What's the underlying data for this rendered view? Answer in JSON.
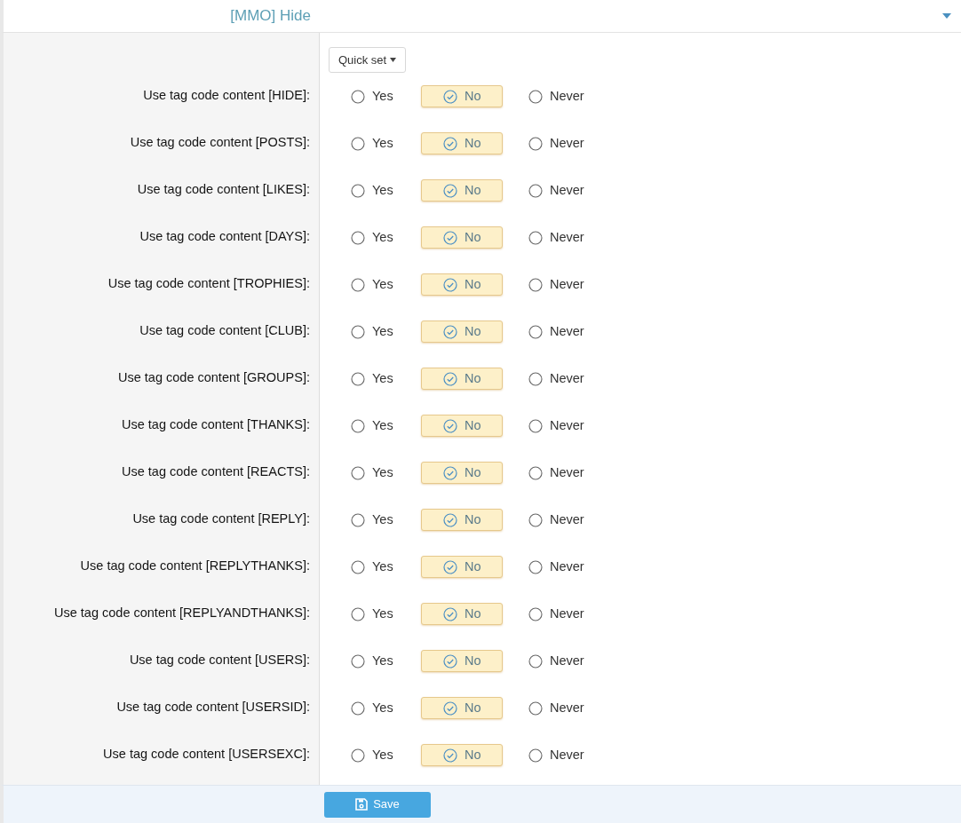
{
  "header": {
    "title": "[MMO] Hide"
  },
  "quick_set": {
    "label": "Quick set"
  },
  "rows": [
    {
      "label": "Use tag code content [HIDE]:",
      "options": [
        {
          "label": "Yes",
          "selected": false
        },
        {
          "label": "No",
          "selected": true
        },
        {
          "label": "Never",
          "selected": false
        }
      ]
    },
    {
      "label": "Use tag code content [POSTS]:",
      "options": [
        {
          "label": "Yes",
          "selected": false
        },
        {
          "label": "No",
          "selected": true
        },
        {
          "label": "Never",
          "selected": false
        }
      ]
    },
    {
      "label": "Use tag code content [LIKES]:",
      "options": [
        {
          "label": "Yes",
          "selected": false
        },
        {
          "label": "No",
          "selected": true
        },
        {
          "label": "Never",
          "selected": false
        }
      ]
    },
    {
      "label": "Use tag code content [DAYS]:",
      "options": [
        {
          "label": "Yes",
          "selected": false
        },
        {
          "label": "No",
          "selected": true
        },
        {
          "label": "Never",
          "selected": false
        }
      ]
    },
    {
      "label": "Use tag code content [TROPHIES]:",
      "options": [
        {
          "label": "Yes",
          "selected": false
        },
        {
          "label": "No",
          "selected": true
        },
        {
          "label": "Never",
          "selected": false
        }
      ]
    },
    {
      "label": "Use tag code content [CLUB]:",
      "options": [
        {
          "label": "Yes",
          "selected": false
        },
        {
          "label": "No",
          "selected": true
        },
        {
          "label": "Never",
          "selected": false
        }
      ]
    },
    {
      "label": "Use tag code content [GROUPS]:",
      "options": [
        {
          "label": "Yes",
          "selected": false
        },
        {
          "label": "No",
          "selected": true
        },
        {
          "label": "Never",
          "selected": false
        }
      ]
    },
    {
      "label": "Use tag code content [THANKS]:",
      "options": [
        {
          "label": "Yes",
          "selected": false
        },
        {
          "label": "No",
          "selected": true
        },
        {
          "label": "Never",
          "selected": false
        }
      ]
    },
    {
      "label": "Use tag code content [REACTS]:",
      "options": [
        {
          "label": "Yes",
          "selected": false
        },
        {
          "label": "No",
          "selected": true
        },
        {
          "label": "Never",
          "selected": false
        }
      ]
    },
    {
      "label": "Use tag code content [REPLY]:",
      "options": [
        {
          "label": "Yes",
          "selected": false
        },
        {
          "label": "No",
          "selected": true
        },
        {
          "label": "Never",
          "selected": false
        }
      ]
    },
    {
      "label": "Use tag code content [REPLYTHANKS]:",
      "options": [
        {
          "label": "Yes",
          "selected": false
        },
        {
          "label": "No",
          "selected": true
        },
        {
          "label": "Never",
          "selected": false
        }
      ]
    },
    {
      "label": "Use tag code content [REPLYANDTHANKS]:",
      "options": [
        {
          "label": "Yes",
          "selected": false
        },
        {
          "label": "No",
          "selected": true
        },
        {
          "label": "Never",
          "selected": false
        }
      ]
    },
    {
      "label": "Use tag code content [USERS]:",
      "options": [
        {
          "label": "Yes",
          "selected": false
        },
        {
          "label": "No",
          "selected": true
        },
        {
          "label": "Never",
          "selected": false
        }
      ]
    },
    {
      "label": "Use tag code content [USERSID]:",
      "options": [
        {
          "label": "Yes",
          "selected": false
        },
        {
          "label": "No",
          "selected": true
        },
        {
          "label": "Never",
          "selected": false
        }
      ]
    },
    {
      "label": "Use tag code content [USERSEXC]:",
      "options": [
        {
          "label": "Yes",
          "selected": false
        },
        {
          "label": "No",
          "selected": true
        },
        {
          "label": "Never",
          "selected": false
        }
      ]
    }
  ],
  "save_button": {
    "label": "Save"
  }
}
